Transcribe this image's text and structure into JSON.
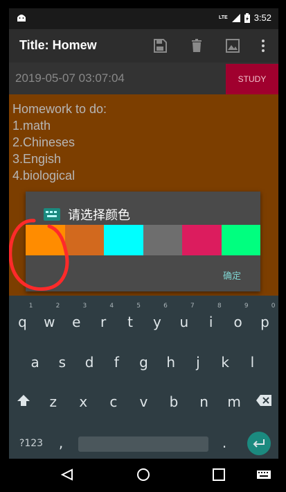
{
  "status_bar": {
    "network": "LTE",
    "time": "3:52",
    "icons": [
      "android-icon",
      "signal-icon",
      "battery-icon"
    ]
  },
  "app_bar": {
    "title": "Title: Homew",
    "icons": [
      "save-icon",
      "trash-icon",
      "image-icon",
      "more-vert-icon"
    ]
  },
  "date_row": {
    "date": "2019-05-07 03:07:04",
    "study_label": "STUDY"
  },
  "note": {
    "text": "Homework to do:\n1.math\n2.Chineses\n3.Engish\n4.biological"
  },
  "dialog": {
    "title": "请选择颜色",
    "ok_label": "确定",
    "swatches": [
      {
        "name": "orange",
        "color": "#ff8c00"
      },
      {
        "name": "dark-orange",
        "color": "#d2691e"
      },
      {
        "name": "cyan",
        "color": "#00ffff"
      },
      {
        "name": "gray",
        "color": "#6e6e6e"
      },
      {
        "name": "crimson",
        "color": "#dc1c5e"
      },
      {
        "name": "spring-green",
        "color": "#00ff7f"
      }
    ]
  },
  "keyboard": {
    "row1": [
      {
        "key": "q",
        "num": "1"
      },
      {
        "key": "w",
        "num": "2"
      },
      {
        "key": "e",
        "num": "3"
      },
      {
        "key": "r",
        "num": "4"
      },
      {
        "key": "t",
        "num": "5"
      },
      {
        "key": "y",
        "num": "6"
      },
      {
        "key": "u",
        "num": "7"
      },
      {
        "key": "i",
        "num": "8"
      },
      {
        "key": "o",
        "num": "9"
      },
      {
        "key": "p",
        "num": "0"
      }
    ],
    "row2": [
      "a",
      "s",
      "d",
      "f",
      "g",
      "h",
      "j",
      "k",
      "l"
    ],
    "row3": [
      "z",
      "x",
      "c",
      "v",
      "b",
      "n",
      "m"
    ],
    "symbols_label": "?123",
    "comma": ",",
    "period": "."
  },
  "nav_bar": {
    "icons": [
      "back-icon",
      "home-icon",
      "recents-icon",
      "keyboard-switch-icon"
    ]
  },
  "colors": {
    "study_bg": "#a0002e",
    "note_bg": "#7c3e00",
    "accent": "#7fd3d0",
    "annotation": "#ff2a2a"
  }
}
